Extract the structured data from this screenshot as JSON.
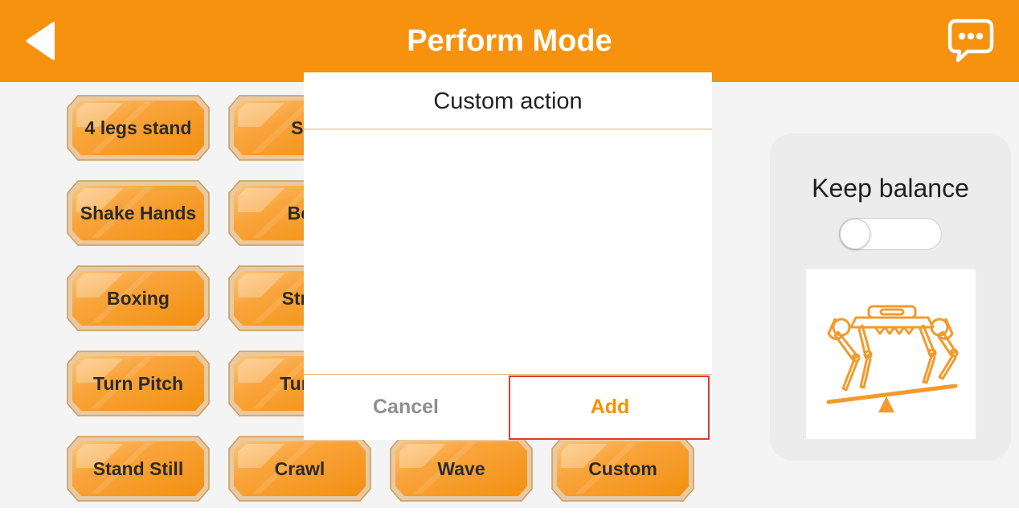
{
  "header": {
    "title": "Perform Mode",
    "back_icon": "back-arrow-icon",
    "chat_icon": "chat-bubble-icon",
    "accent_color": "#f7920f"
  },
  "actions": [
    "4 legs stand",
    "Si",
    "Shake Hands",
    "Bo",
    "Boxing",
    "Stre",
    "Turn Pitch",
    "Turn",
    "Stand Still",
    "Crawl",
    "Wave",
    "Custom"
  ],
  "dialog": {
    "title": "Custom action",
    "cancel_label": "Cancel",
    "add_label": "Add"
  },
  "side_panel": {
    "title": "Keep balance",
    "toggle_on": false,
    "robot_icon": "balance-robot-illustration"
  }
}
